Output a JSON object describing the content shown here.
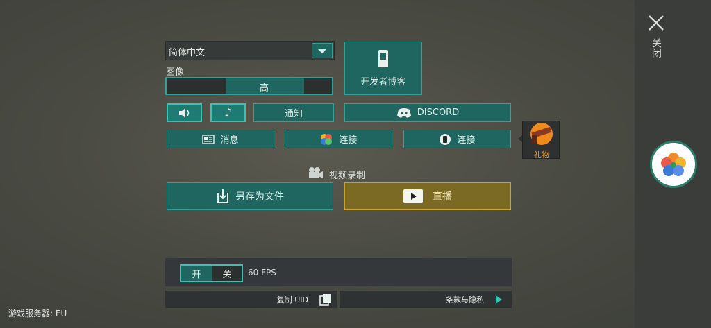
{
  "language": {
    "selected": "简体中文"
  },
  "graphics": {
    "label": "图像",
    "value": "高",
    "fill": 0.8
  },
  "dev_blog": {
    "label": "开发者博客"
  },
  "sound": {
    "notify_label": "通知"
  },
  "discord": {
    "label": "DISCORD"
  },
  "news": {
    "label": "消息"
  },
  "connect1": {
    "label": "连接"
  },
  "connect2": {
    "label": "连接"
  },
  "gift": {
    "label": "礼物"
  },
  "video": {
    "label": "视频录制"
  },
  "save_file": {
    "label": "另存为文件"
  },
  "live": {
    "label": "直播"
  },
  "fps": {
    "on": "开",
    "off": "关",
    "value": "60 FPS"
  },
  "copy_uid": {
    "label": "复制 UID"
  },
  "terms": {
    "label": "条款与隐私"
  },
  "server": {
    "label": "游戏服务器: EU"
  },
  "close": {
    "label": "关闭"
  },
  "colors": {
    "accent": "#1f6661",
    "border": "#2fa39a",
    "live": "#7a6a24",
    "live_border": "#c9a227"
  }
}
